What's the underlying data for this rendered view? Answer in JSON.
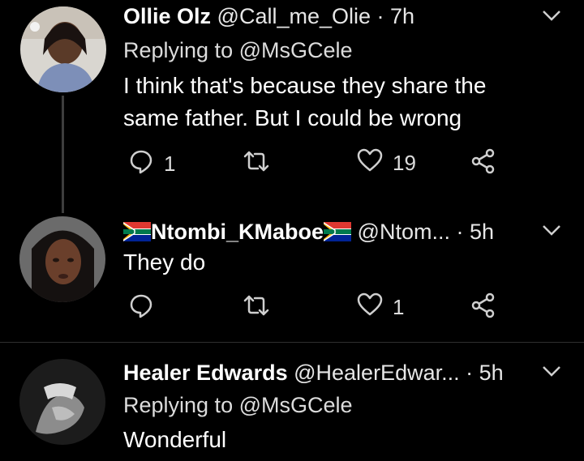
{
  "tweets": [
    {
      "name": "Ollie Olz",
      "handle": "@Call_me_Olie",
      "time": "· 7h",
      "replying": "Replying to @MsGCele",
      "body": "I think that's because they share the same father. But I could be wrong",
      "reply_count": "1",
      "like_count": "19"
    },
    {
      "name": "Ntombi_KMaboe",
      "handle": "@Ntom...",
      "time": "· 5h",
      "body": "They do",
      "reply_count": "",
      "like_count": "1"
    },
    {
      "name": "Healer Edwards",
      "handle": "@HealerEdwar...",
      "time": "· 5h",
      "replying": "Replying to @MsGCele",
      "body": "Wonderful"
    }
  ],
  "colors": {
    "background": "#000000",
    "icon": "#cfcfcf",
    "text": "#ffffff"
  },
  "icons": [
    "reply-icon",
    "retweet-icon",
    "like-icon",
    "share-icon",
    "chevron-down-icon",
    "south-africa-flag-icon"
  ]
}
